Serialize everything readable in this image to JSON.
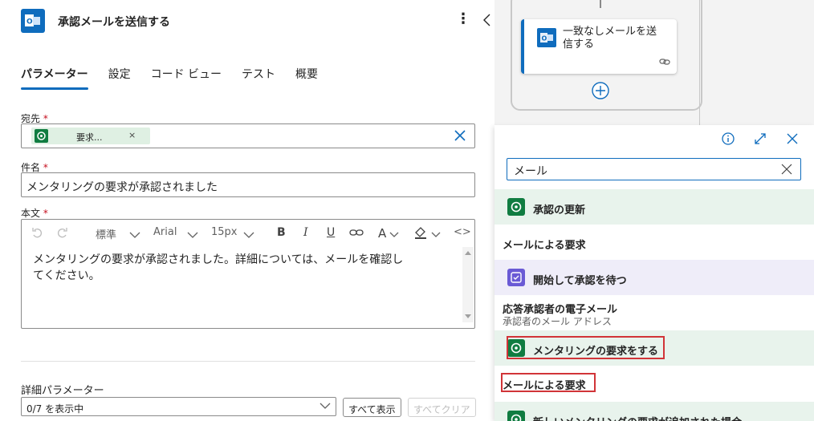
{
  "header": {
    "title": "承認メールを送信する",
    "more": "⋮"
  },
  "tabs": [
    "パラメーター",
    "設定",
    "コード ビュー",
    "テスト",
    "概要"
  ],
  "to": {
    "label": "宛先",
    "required": "*",
    "chip": "要求...",
    "chip_close": "×"
  },
  "subject": {
    "label": "件名",
    "required": "*",
    "value": "メンタリングの要求が承認されました"
  },
  "body": {
    "label": "本文",
    "required": "*",
    "style": "標準",
    "font": "Arial",
    "size": "15px",
    "bold": "B",
    "italic": "I",
    "underline": "U",
    "font_color": "A",
    "code": "<>",
    "text": "メンタリングの要求が承認されました。詳細については、メールを確認してください。"
  },
  "advanced": {
    "label": "詳細パラメーター",
    "select_value": "0/7 を表示中",
    "show_all": "すべて表示",
    "clear_all": "すべてクリア"
  },
  "canvas": {
    "card_text": "一致なしメールを送信する"
  },
  "panel": {
    "search_value": "メール",
    "items": [
      {
        "kind": "action",
        "color": "green",
        "text": "承認の更新"
      },
      {
        "kind": "header",
        "text": "メールによる要求"
      },
      {
        "kind": "action",
        "color": "purple",
        "text": "開始して承認を待つ"
      },
      {
        "kind": "header",
        "text": "応答承認者の電子メール",
        "sub": "承認者のメール アドレス"
      },
      {
        "kind": "action",
        "color": "green",
        "text": "メンタリングの要求をする"
      },
      {
        "kind": "header",
        "text": "メールによる要求"
      },
      {
        "kind": "action",
        "color": "green",
        "text": "新しいメンタリングの要求が追加された場合"
      }
    ]
  },
  "colors": {
    "accent": "#0f6cbd",
    "green": "#107c41",
    "purple": "#6a5ad5",
    "highlight": "#d13438"
  }
}
